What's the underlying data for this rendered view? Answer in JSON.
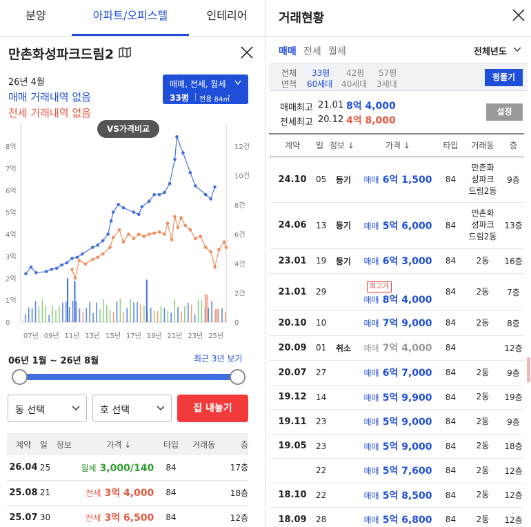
{
  "top_tabs": [
    "분양",
    "아파트/오피스텔",
    "인테리어"
  ],
  "apt": {
    "name": "만촌화성파크드림2",
    "month": "26년 4월",
    "sale_status": "매매 거래내역 없음",
    "jeonse_status": "전세 거래내역 없음",
    "filter_line1": "매매, 전세, 월세",
    "filter_line2": "33평",
    "filter_line3": "전용 84㎡",
    "vs_button": "VS가격비교"
  },
  "chart_data": {
    "type": "line",
    "x_ticks": [
      "07년",
      "09년",
      "11년",
      "13년",
      "15년",
      "17년",
      "19년",
      "21년",
      "23년",
      "25년"
    ],
    "y_left_ticks": [
      "0",
      "1억",
      "2억",
      "3억",
      "4억",
      "5억",
      "6억",
      "7억",
      "8억"
    ],
    "y_right_ticks": [
      "0",
      "2건",
      "4건",
      "6건",
      "8건",
      "10건",
      "12건"
    ],
    "series": [
      {
        "name": "매매",
        "color": "#3f6ee0",
        "points": [
          [
            2006.5,
            2.2
          ],
          [
            2007,
            2.5
          ],
          [
            2007.5,
            2.25
          ],
          [
            2008.5,
            2.3
          ],
          [
            2009,
            2.4
          ],
          [
            2009.5,
            2.45
          ],
          [
            2010,
            2.6
          ],
          [
            2010.5,
            2.7
          ],
          [
            2011,
            2.9
          ],
          [
            2011.5,
            2.95
          ],
          [
            2012,
            3.1
          ],
          [
            2013,
            3.4
          ],
          [
            2013.5,
            3.5
          ],
          [
            2014,
            3.7
          ],
          [
            2014.5,
            4.0
          ],
          [
            2014.8,
            4.6
          ],
          [
            2015,
            5.0
          ],
          [
            2015.5,
            5.35
          ],
          [
            2016,
            5.2
          ],
          [
            2017,
            5.0
          ],
          [
            2017.5,
            4.9
          ],
          [
            2017.8,
            5.25
          ],
          [
            2018.5,
            5.5
          ],
          [
            2019,
            5.8
          ],
          [
            2019.5,
            5.8
          ],
          [
            2020,
            5.9
          ],
          [
            2020.5,
            6.3
          ],
          [
            2021,
            7.4
          ],
          [
            2021.2,
            8.43
          ],
          [
            2021.8,
            7.7
          ],
          [
            2022.5,
            6.8
          ],
          [
            2023,
            6.2
          ],
          [
            2024,
            5.8
          ],
          [
            2024.5,
            5.6
          ],
          [
            2024.9,
            6.15
          ]
        ]
      },
      {
        "name": "전세",
        "color": "#f08a5a",
        "points": [
          [
            2011,
            2.4
          ],
          [
            2011.3,
            2.0
          ],
          [
            2011.7,
            2.8
          ],
          [
            2012.3,
            2.65
          ],
          [
            2013,
            2.85
          ],
          [
            2013.5,
            2.95
          ],
          [
            2014,
            3.1
          ],
          [
            2014.7,
            3.4
          ],
          [
            2015,
            3.85
          ],
          [
            2015.6,
            4.2
          ],
          [
            2016,
            3.65
          ],
          [
            2016.5,
            4.0
          ],
          [
            2017,
            3.8
          ],
          [
            2017.5,
            4.0
          ],
          [
            2018,
            3.9
          ],
          [
            2018.5,
            4.0
          ],
          [
            2019,
            4.05
          ],
          [
            2019.5,
            4.1
          ],
          [
            2020,
            4.0
          ],
          [
            2020.3,
            4.5
          ],
          [
            2020.7,
            3.75
          ],
          [
            2021,
            4.8
          ],
          [
            2021.3,
            4.3
          ],
          [
            2021.6,
            4.75
          ],
          [
            2022,
            4.4
          ],
          [
            2022.5,
            4.2
          ],
          [
            2023,
            3.8
          ],
          [
            2023.5,
            3.9
          ],
          [
            2024,
            3.4
          ],
          [
            2024.5,
            3.2
          ],
          [
            2024.9,
            2.5
          ],
          [
            2025.3,
            3.3
          ],
          [
            2025.8,
            3.65
          ],
          [
            2026,
            3.4
          ]
        ]
      }
    ]
  },
  "range": {
    "label": "06년 1월 ~ 26년 8월",
    "link": "최근 3년 보기"
  },
  "selects": {
    "dong": "동 선택",
    "ho": "호 선택",
    "action": "집 내놓기"
  },
  "left_table": {
    "headers": [
      "계약",
      "일",
      "정보",
      "가격 ↓",
      "타입",
      "거래동",
      "층"
    ],
    "rows": [
      {
        "date": "26.04",
        "day": "25",
        "info": "",
        "kind": "월세",
        "price": "3,000/140",
        "type": "84",
        "dong": "",
        "floor": "17층",
        "color": "green"
      },
      {
        "date": "25.08",
        "day": "21",
        "info": "",
        "kind": "전세",
        "price": "3억 4,000",
        "type": "84",
        "dong": "",
        "floor": "18층",
        "color": "red"
      },
      {
        "date": "25.07",
        "day": "30",
        "info": "",
        "kind": "전세",
        "price": "3억 6,500",
        "type": "84",
        "dong": "",
        "floor": "12층",
        "color": "red"
      }
    ]
  },
  "right": {
    "title": "거래현황",
    "type_tabs": [
      "매매",
      "전세",
      "월세"
    ],
    "year_select": "전체년도",
    "pyeong_row1": [
      "전체",
      "33평",
      "42평",
      "57평"
    ],
    "pyeong_row2": [
      "면적",
      "60세대",
      "40세대",
      "3세대"
    ],
    "pyeong_button": "평풀기",
    "max_sale_label": "매매최고",
    "max_sale_date": "21.01",
    "max_sale_price": "8억 4,000",
    "max_jeonse_label": "전세최고",
    "max_jeonse_date": "20.12",
    "max_jeonse_price": "4억 8,000",
    "settings_button": "설정",
    "headers": [
      "계약",
      "일",
      "정보 ↓",
      "가격 ↓",
      "타입",
      "거래동",
      "층"
    ],
    "rows": [
      {
        "date": "24.10",
        "day": "05",
        "info": "등기",
        "kind": "매매",
        "price": "6억 1,500",
        "type": "84",
        "dong": "만촌화\n성파크\n드림2동",
        "floor": "9층",
        "badge": "",
        "cancel": false,
        "h": 66
      },
      {
        "date": "24.06",
        "day": "13",
        "info": "등기",
        "kind": "매매",
        "price": "5억 6,000",
        "type": "84",
        "dong": "만촌화\n성파크\n드림2동",
        "floor": "13층",
        "badge": "",
        "cancel": false,
        "h": 67
      },
      {
        "date": "23.01",
        "day": "19",
        "info": "등기",
        "kind": "매매",
        "price": "6억 3,000",
        "type": "84",
        "dong": "2동",
        "floor": "16층",
        "badge": "",
        "cancel": false,
        "h": 36
      },
      {
        "date": "21.01",
        "day": "29",
        "info": "",
        "kind": "매매",
        "price": "8억 4,000",
        "type": "84",
        "dong": "2동",
        "floor": "7층",
        "badge": "최고가",
        "cancel": false,
        "h": 54
      },
      {
        "date": "20.10",
        "day": "10",
        "info": "",
        "kind": "매매",
        "price": "7억 9,000",
        "type": "84",
        "dong": "2동",
        "floor": "8층",
        "badge": "",
        "cancel": false,
        "h": 36
      },
      {
        "date": "20.09",
        "day": "01",
        "info": "취소",
        "kind": "매매",
        "price": "7억 4,000",
        "type": "84",
        "dong": "",
        "floor": "12층",
        "badge": "",
        "cancel": true,
        "h": 36
      },
      {
        "date": "20.07",
        "day": "27",
        "info": "",
        "kind": "매매",
        "price": "6억 7,000",
        "type": "84",
        "dong": "2동",
        "floor": "9층",
        "badge": "",
        "cancel": false,
        "h": 36
      },
      {
        "date": "19.12",
        "day": "14",
        "info": "",
        "kind": "매매",
        "price": "5억 9,900",
        "type": "84",
        "dong": "2동",
        "floor": "19층",
        "badge": "",
        "cancel": false,
        "h": 35
      },
      {
        "date": "19.11",
        "day": "23",
        "info": "",
        "kind": "매매",
        "price": "5억 9,000",
        "type": "84",
        "dong": "2동",
        "floor": "9층",
        "badge": "",
        "cancel": false,
        "h": 36
      },
      {
        "date": "19.05",
        "day": "23",
        "info": "",
        "kind": "매매",
        "price": "5억 9,000",
        "type": "84",
        "dong": "2동",
        "floor": "18층",
        "badge": "",
        "cancel": false,
        "h": 35
      },
      {
        "date": "",
        "day": "22",
        "info": "",
        "kind": "매매",
        "price": "5억 7,600",
        "type": "84",
        "dong": "2동",
        "floor": "12층",
        "badge": "",
        "cancel": false,
        "h": 36
      },
      {
        "date": "18.10",
        "day": "22",
        "info": "",
        "kind": "매매",
        "price": "5억 8,500",
        "type": "84",
        "dong": "2동",
        "floor": "12층",
        "badge": "",
        "cancel": false,
        "h": 35
      },
      {
        "date": "18.09",
        "day": "28",
        "info": "",
        "kind": "매매",
        "price": "5억 6,800",
        "type": "84",
        "dong": "2동",
        "floor": "12층",
        "badge": "",
        "cancel": false,
        "h": 36
      }
    ]
  },
  "colors": {
    "brand": "#1f4fd8",
    "accent_red": "#f23a3a",
    "sale": "#3f6ee0",
    "jeonse": "#f08a5a"
  }
}
